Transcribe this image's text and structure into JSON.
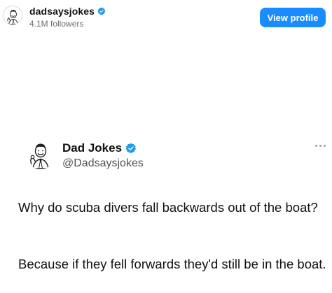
{
  "header": {
    "username": "dadsaysjokes",
    "followers": "4.1M followers",
    "view_profile_label": "View profile",
    "avatar_icon": "cartoon-man-avatar-icon",
    "verified_icon": "verified-badge-icon"
  },
  "tweet": {
    "display_name": "Dad Jokes",
    "handle": "@Dadsaysjokes",
    "question": "Why do scuba divers fall backwards out of the boat?",
    "answer": "Because if they fell forwards they'd still be in the boat.",
    "more_icon": "more-options-icon"
  },
  "colors": {
    "primary_button": "#1a8cff",
    "verified": "#1d9bf0",
    "secondary_text": "#6b6b6b"
  }
}
